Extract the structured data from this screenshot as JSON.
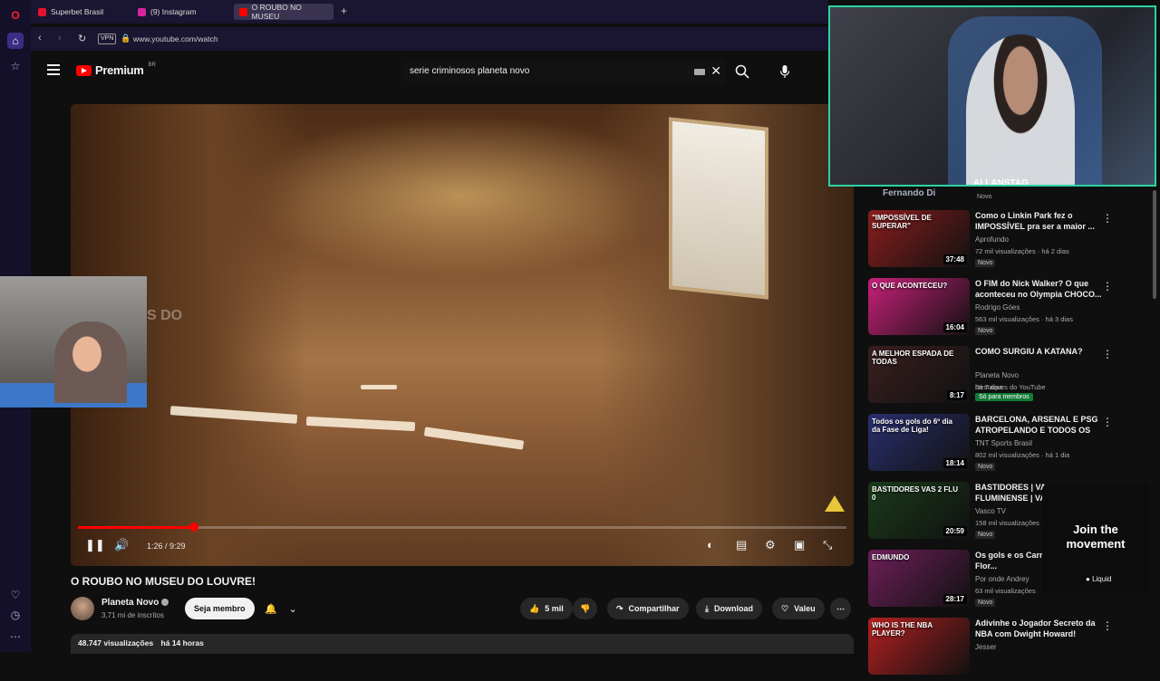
{
  "browser": {
    "tabs": [
      {
        "label": "Superbet Brasil",
        "color": "#e4112f"
      },
      {
        "label": "(9) Instagram",
        "color": "#d6249f"
      },
      {
        "label": "O ROUBO NO MUSEU",
        "color": "#ff0000"
      }
    ],
    "vpn_label": "VPN",
    "url": "www.youtube.com/watch"
  },
  "youtube": {
    "logo_text": "Premium",
    "logo_region": "BR",
    "search_query": "serie criminosos planeta novo"
  },
  "player": {
    "time": "1:26 / 9:29",
    "progress": 0.151,
    "watermark": "S DO"
  },
  "video": {
    "title": "O ROUBO NO MUSEU DO LOUVRE!",
    "channel": "Planeta Novo",
    "subscribers": "3,71 mi de inscritos",
    "member_label": "Seja membro",
    "likes": "5 mil",
    "share_label": "Compartilhar",
    "download_label": "Download",
    "thanks_label": "Valeu",
    "views": "48.747 visualizações",
    "age": "há 14 horas"
  },
  "stream": {
    "streamer_name": "ALLANSTAG",
    "accent": "#2cd3a1"
  },
  "sidebar": {
    "partial_channel": "Fernando Di",
    "partial_badge": "Novo",
    "recs": [
      {
        "title": "Como o Linkin Park fez o IMPOSSÍVEL pra ser a maior ...",
        "channel": "Aprofundo",
        "meta": "72 mil visualizações · há 2 dias",
        "badge": "Novo",
        "duration": "37:48",
        "thumb_caption": "\"IMPOSSÍVEL DE SUPERAR\"",
        "thumb_color": "#8b1d1d"
      },
      {
        "title": "O FIM do Nick Walker? O que aconteceu no Olympia CHOCO...",
        "channel": "Rodrigo Góes",
        "meta": "563 mil visualizações · há 3 dias",
        "badge": "Novo",
        "duration": "16:04",
        "thumb_caption": "O QUE ACONTECEU?",
        "thumb_color": "#c8207a"
      },
      {
        "title": "COMO SURGIU A KATANA?",
        "channel": "Planeta Novo",
        "meta": "há 7 dias",
        "badge": "Destaques do YouTube",
        "members": "Só para membros",
        "duration": "8:17",
        "thumb_caption": "A MELHOR ESPADA DE TODAS",
        "thumb_color": "#3a1f1f"
      },
      {
        "title": "BARCELONA, ARSENAL E PSG ATROPELANDO E TODOS OS 4...",
        "channel": "TNT Sports Brasil",
        "meta": "802 mil visualizações · há 1 dia",
        "badge": "Novo",
        "duration": "18:14",
        "thumb_caption": "Todos os gols do 6º dia da Fase de Liga!",
        "thumb_color": "#2a2f6e"
      },
      {
        "title": "BASTIDORES | VA... FLUMINENSE | VA...",
        "channel": "Vasco TV",
        "meta": "158 mil visualizações",
        "badge": "Novo",
        "duration": "20:59",
        "thumb_caption": "BASTIDORES VAS 2 FLU 0",
        "thumb_color": "#1a3a1a"
      },
      {
        "title": "Os gols e os Carr... Edmundo na Flor...",
        "channel": "Por onde Andrey",
        "meta": "63 mil visualizações",
        "badge": "Novo",
        "duration": "28:17",
        "thumb_caption": "EDMUNDO",
        "thumb_color": "#6e1f5a"
      },
      {
        "title": "Adivinhe o Jogador Secreto da NBA com Dwight Howard!",
        "channel": "Jesser",
        "meta": "",
        "badge": "",
        "duration": "",
        "thumb_caption": "WHO IS THE NBA PLAYER?",
        "thumb_color": "#b32020"
      }
    ]
  },
  "ad": {
    "text_line1": "Join the",
    "text_line2": "movement",
    "brand": "Liquid"
  }
}
